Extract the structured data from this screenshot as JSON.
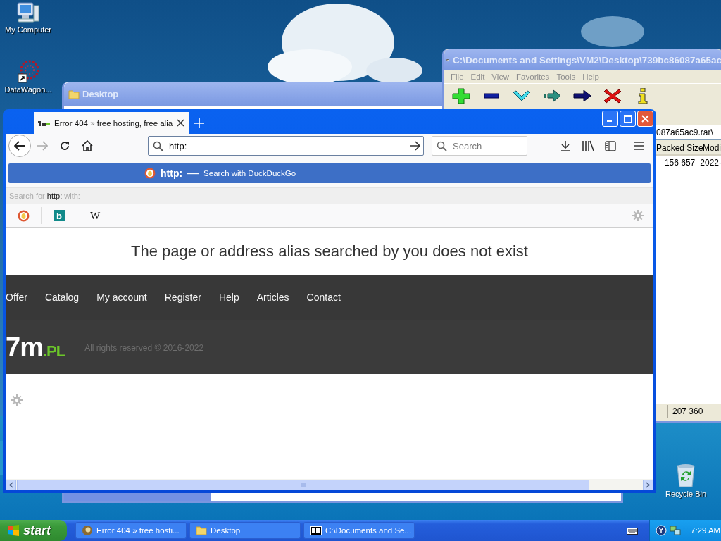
{
  "desktop": {
    "icons": [
      {
        "kind": "computer",
        "label": "My Computer"
      },
      {
        "kind": "shortcut",
        "label": "DataWagon..."
      },
      {
        "kind": "recycle",
        "label": "Recycle Bin"
      }
    ]
  },
  "explorer_window": {
    "title": "Desktop"
  },
  "archive_window": {
    "title": "C:\\Documents and Settings\\VM2\\Desktop\\739bc86087a65ac",
    "menu": [
      "File",
      "Edit",
      "View",
      "Favorites",
      "Tools",
      "Help"
    ],
    "address": "087a65ac9.rar\\",
    "columns": [
      "Packed Size",
      "Modi"
    ],
    "rows": [
      [
        "156 657",
        "2022-"
      ]
    ],
    "status": "207 360"
  },
  "browser": {
    "tab": {
      "title": "Error 404 » free hosting, free alia",
      "selected": true
    },
    "url": "http:",
    "search_placeholder": "Search",
    "suggestion": {
      "query": "http:",
      "separator": "—",
      "action": "Search with DuckDuckGo",
      "selected": true
    },
    "search_hint": "Search for **http:** with:",
    "engines": [
      {
        "kind": "duck"
      },
      {
        "kind": "tile",
        "label": "b"
      },
      {
        "kind": "letter",
        "label": "W"
      }
    ],
    "page": {
      "heading": "The page or address alias searched by you does not exist",
      "nav": [
        "Offer",
        "Catalog",
        "My account",
        "Register",
        "Help",
        "Articles",
        "Contact"
      ],
      "logo": {
        "main": "7m",
        "suffix": ".PL"
      },
      "copyright": "All rights reserved © 2016-2022"
    }
  },
  "taskbar": {
    "start": "start",
    "tasks": [
      {
        "kind": "browser",
        "label": "Error 404 » free hosti..."
      },
      {
        "kind": "folder",
        "label": "Desktop"
      },
      {
        "kind": "archive",
        "label": "C:\\Documents and Se..."
      }
    ],
    "clock": "7:29 AM"
  }
}
